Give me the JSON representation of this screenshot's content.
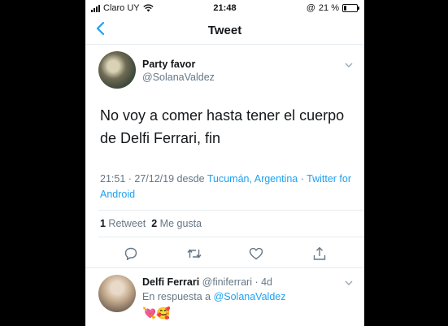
{
  "status_bar": {
    "carrier": "Claro UY",
    "time": "21:48",
    "battery_prefix": "@",
    "battery_pct": "21 %",
    "battery_level": 0.21
  },
  "navbar": {
    "title": "Tweet",
    "back_icon": "chevron-left-icon"
  },
  "tweet": {
    "author_name": "Party favor",
    "author_handle": "@SolanaValdez",
    "text": "No voy a comer hasta tener el cuerpo de Delfi Ferrari, fin",
    "timestamp": "21:51 · 27/12/19 desde ",
    "location": "Tucumán, Argentina",
    "separator": " · ",
    "source": "Twitter for Android",
    "retweet_count": "1",
    "retweet_label": " Retweet  ",
    "like_count": "2",
    "like_label": " Me gusta"
  },
  "actions": [
    "reply-icon",
    "retweet-icon",
    "like-icon",
    "share-icon"
  ],
  "reply": {
    "name": "Delfi Ferrari",
    "handle": "@finiferrari",
    "age": " · 4d",
    "reply_prefix": "En respuesta a ",
    "reply_to": "@SolanaValdez",
    "emojis": "💘🥰"
  },
  "colors": {
    "accent": "#1da1f2",
    "text": "#14171a",
    "muted": "#657786"
  }
}
